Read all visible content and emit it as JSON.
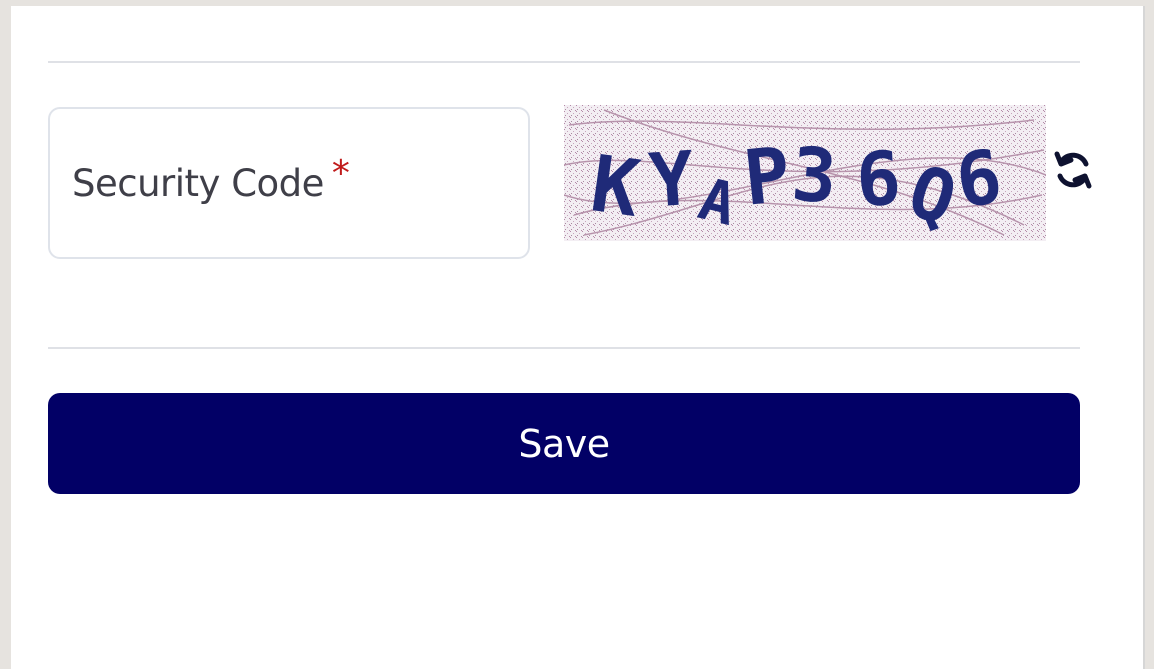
{
  "form": {
    "security_code_label": "Security Code",
    "required_mark": "*",
    "security_code_value": ""
  },
  "captcha": {
    "text": "KYAP36Q6",
    "refresh_icon": "refresh-icon"
  },
  "actions": {
    "save_label": "Save"
  },
  "colors": {
    "primary": "#020066",
    "required": "#c01b1b",
    "captcha_text": "#1f2a78",
    "captcha_noise": "#b48aa8"
  }
}
